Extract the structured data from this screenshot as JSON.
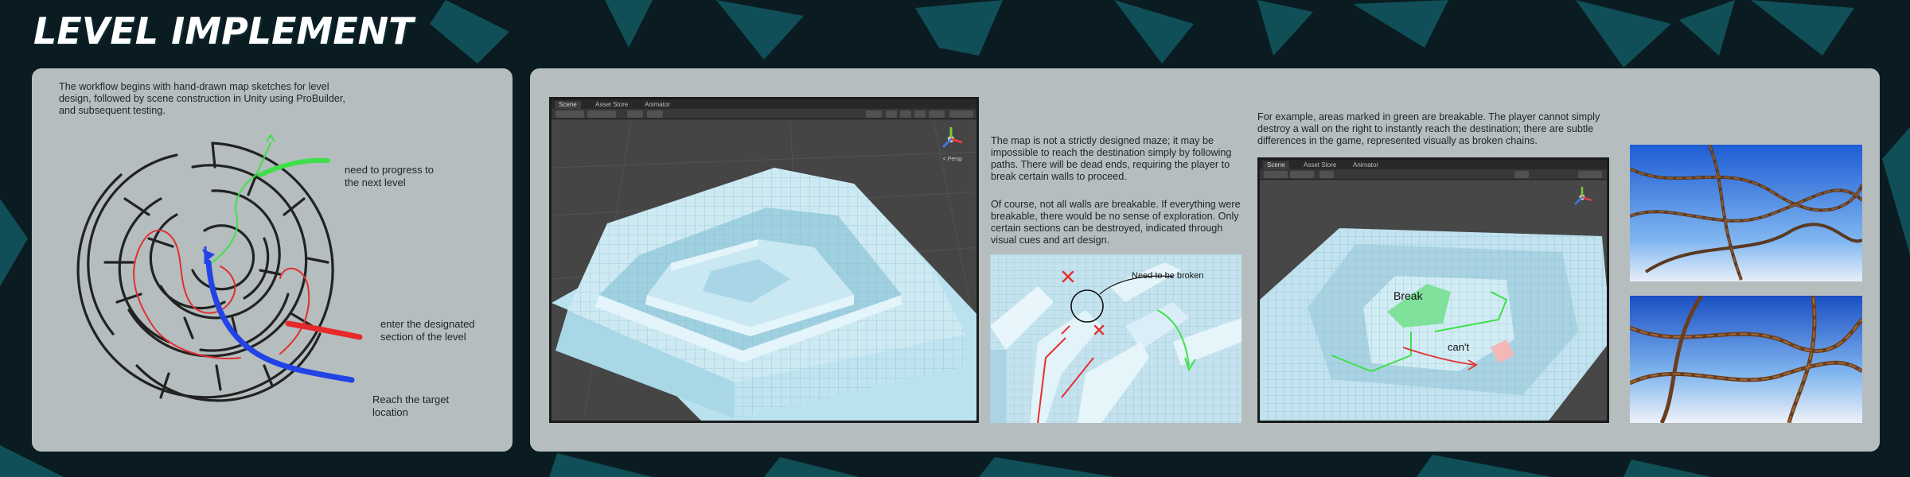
{
  "page_title": "LEVEL IMPLEMENT",
  "colors": {
    "background": "#0a1c22",
    "panel": "#b5bdbf",
    "accent_teal": "#1aa0a8",
    "maze_red": "#e03030",
    "maze_green": "#3ee04a",
    "maze_blue": "#2244e6"
  },
  "intro_text": "The workflow begins with hand-drawn map sketches for level design, followed by scene construction in Unity using ProBuilder, and subsequent testing.",
  "maze_labels": {
    "progress": "need to progress to the next level",
    "enter": "enter the designated section of the level",
    "reach": "Reach the target location"
  },
  "map_text_1": "The map is not a strictly designed maze; it may be impossible to reach the destination simply by following paths. There will be dead ends, requiring the player to break certain walls to proceed.",
  "map_text_2": "Of course, not all walls are breakable. If everything were breakable, there would be no sense of exploration. Only certain sections can be destroyed, indicated through visual cues and art design.",
  "annotation_break_needed": "Need to be broken",
  "example_text": "For example, areas marked in green are breakable. The player cannot simply destroy a wall on the right to instantly reach the destination; there are subtle differences in the game, represented visually as broken chains.",
  "annotation_break": "Break",
  "annotation_cant": "can't",
  "unity": {
    "tabs": [
      "Scene",
      "Asset Store",
      "Animator"
    ],
    "pivot": "Pivot",
    "global": "Global",
    "persp": "< Persp"
  },
  "icons": [
    "maze-sketch",
    "unity-scene-view",
    "gizmo-axis-icon",
    "red-x-mark",
    "chain-photo"
  ]
}
